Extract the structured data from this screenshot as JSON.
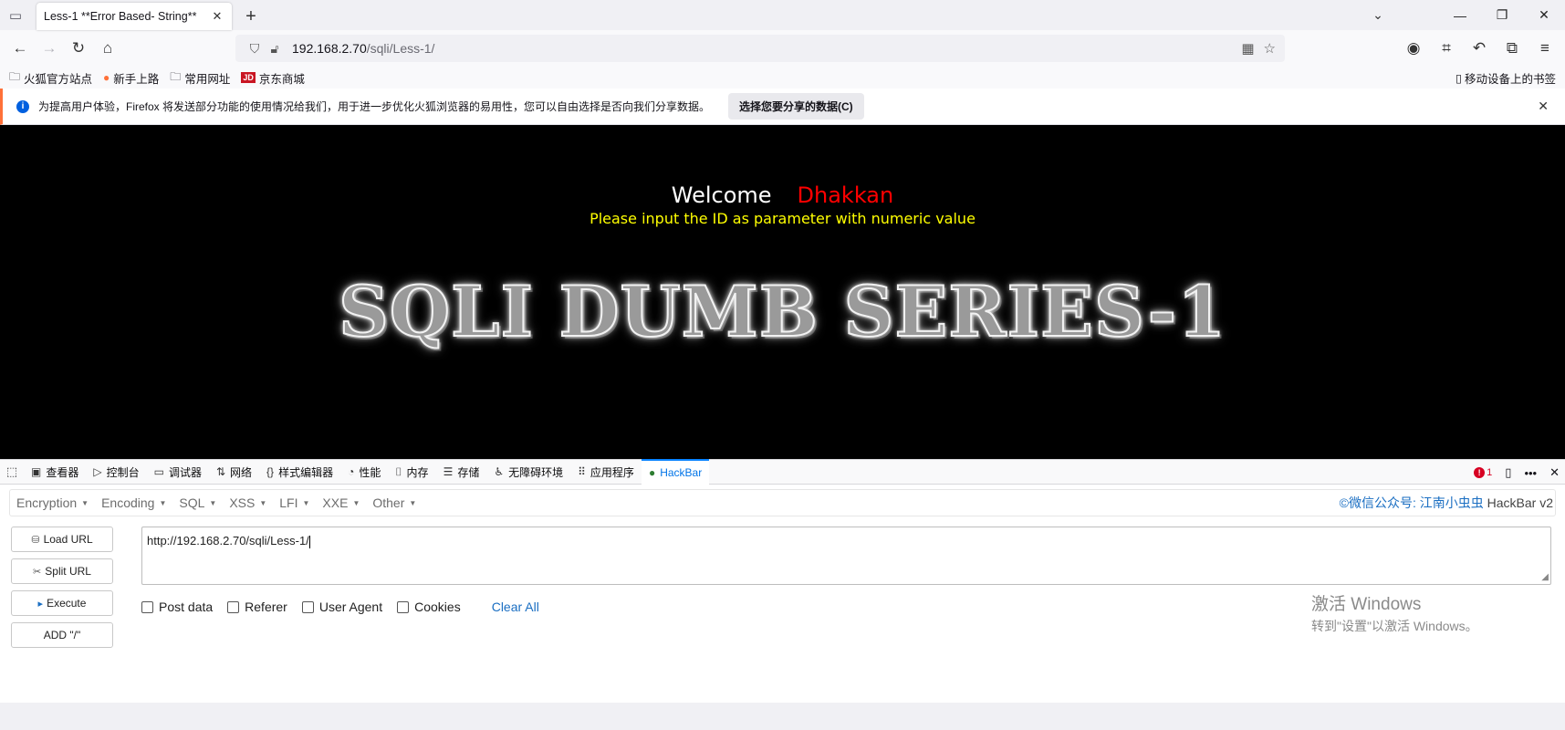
{
  "browser": {
    "tab_title": "Less-1 **Error Based- String**",
    "url_host": "192.168.2.70",
    "url_path": "/sqli/Less-1/"
  },
  "bookmarks": {
    "items": [
      "火狐官方站点",
      "新手上路",
      "常用网址",
      "京东商城"
    ],
    "mobile": "移动设备上的书签"
  },
  "notification": {
    "text": "为提高用户体验，Firefox 将发送部分功能的使用情况给我们，用于进一步优化火狐浏览器的易用性，您可以自由选择是否向我们分享数据。",
    "button": "选择您要分享的数据(C)"
  },
  "page": {
    "welcome": "Welcome",
    "name": "Dhakkan",
    "subtitle": "Please input the ID as parameter with numeric value",
    "banner": "SQLI DUMB SERIES-1"
  },
  "devtools": {
    "tabs": [
      "查看器",
      "控制台",
      "调试器",
      "网络",
      "样式编辑器",
      "性能",
      "内存",
      "存储",
      "无障碍环境",
      "应用程序",
      "HackBar"
    ],
    "error_count": "1"
  },
  "hackbar": {
    "menus": [
      "Encryption",
      "Encoding",
      "SQL",
      "XSS",
      "LFI",
      "XXE",
      "Other"
    ],
    "credit_prefix": "©微信公众号: ",
    "credit_link": "江南小虫虫",
    "credit_suffix": " HackBar v2",
    "buttons": [
      "Load URL",
      "Split URL",
      "Execute",
      "ADD \"/\""
    ],
    "url_value": "http://192.168.2.70/sqli/Less-1/",
    "options": [
      "Post data",
      "Referer",
      "User Agent",
      "Cookies"
    ],
    "clear_all": "Clear All"
  },
  "watermark": {
    "line1": "激活 Windows",
    "line2": "转到\"设置\"以激活 Windows。"
  }
}
